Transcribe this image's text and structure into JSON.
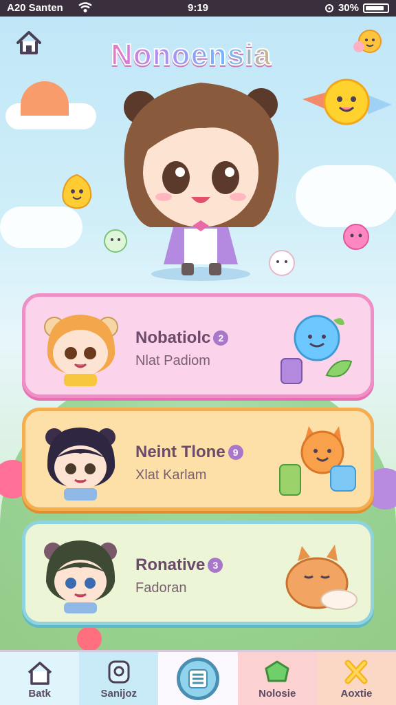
{
  "status_bar": {
    "left_text": "A20 Santen",
    "time": "9:19",
    "battery": "30%"
  },
  "header": {
    "title": "Nonoensia"
  },
  "cards": [
    {
      "title": "Nobatiolc",
      "badge": "2",
      "subtitle": "Nlat Padiom"
    },
    {
      "title": "Neint Tlone",
      "badge": "9",
      "subtitle": "Xlat Karlam"
    },
    {
      "title": "Ronative",
      "badge": "3",
      "subtitle": "Fadoran"
    }
  ],
  "nav": {
    "items": [
      {
        "label": "Batk",
        "icon": "home-icon"
      },
      {
        "label": "Sanijoz",
        "icon": "search-icon"
      },
      {
        "label": "",
        "icon": "list-icon"
      },
      {
        "label": "Nolosie",
        "icon": "gem-icon"
      },
      {
        "label": "Aoxtie",
        "icon": "cross-icon"
      }
    ]
  },
  "colors": {
    "pink_card": "#fbd3ea",
    "orange_card": "#fde0a8",
    "green_card": "#ecf6d7",
    "status_bar": "#3a2f3d"
  }
}
